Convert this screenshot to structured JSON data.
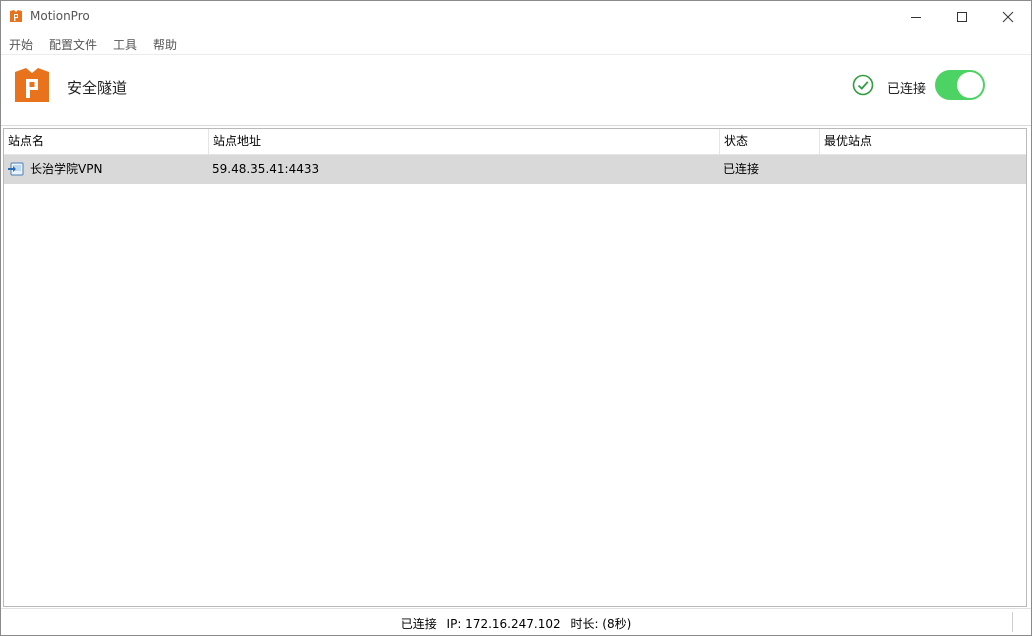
{
  "window": {
    "title": "MotionPro"
  },
  "menu": {
    "items": [
      "开始",
      "配置文件",
      "工具",
      "帮助"
    ]
  },
  "header": {
    "title": "安全隧道",
    "status": "已连接",
    "toggle_on": true
  },
  "colors": {
    "brand_orange": "#e8731c",
    "toggle_green": "#4cd364",
    "check_green": "#2e9e3c",
    "row_selected": "#d9d9d9"
  },
  "icons": {
    "app": "motionpro-logo-icon",
    "check": "check-circle-icon",
    "site": "vpn-site-icon"
  },
  "table": {
    "columns": [
      "站点名",
      "站点地址",
      "状态",
      "最优站点"
    ],
    "rows": [
      {
        "name": "长治学院VPN",
        "address": "59.48.35.41:4433",
        "status": "已连接",
        "best": ""
      }
    ]
  },
  "statusbar": {
    "state": "已连接",
    "ip": "IP: 172.16.247.102",
    "duration": "时长: (8秒)"
  }
}
